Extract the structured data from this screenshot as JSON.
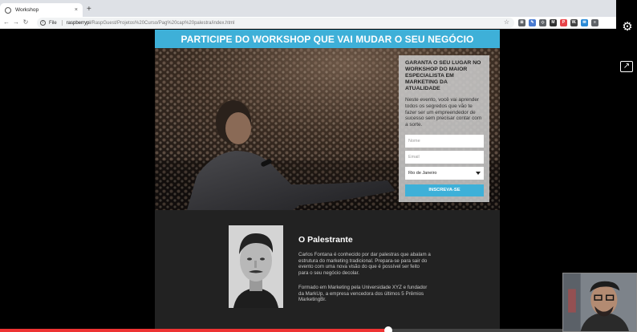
{
  "browser": {
    "tab_title": "Workshop",
    "tab_close": "×",
    "new_tab": "+",
    "back": "←",
    "forward": "→",
    "reload": "↻",
    "scheme_label": "File",
    "url_host": "raspberrypi",
    "url_path": "/RaspGuest/Projetos%20Curso/Pag%20cap%20palestra/index.html",
    "bookmark_star": "☆",
    "extensions": [
      {
        "icon": "grid-icon",
        "color": "#5f6368",
        "label": "⊞"
      },
      {
        "icon": "pin-icon",
        "color": "#4a7bd1",
        "label": "✎"
      },
      {
        "icon": "tag-icon",
        "color": "#5f6368",
        "label": "◇"
      },
      {
        "icon": "m-icon",
        "color": "#333333",
        "label": "M"
      },
      {
        "icon": "pocket-icon",
        "color": "#e8444a",
        "label": "P"
      },
      {
        "icon": "w-icon",
        "color": "#444444",
        "label": "W."
      },
      {
        "icon": "chat-icon",
        "color": "#2b8ad6",
        "label": "✉"
      },
      {
        "icon": "menu-icon",
        "color": "#5f6368",
        "label": "≡"
      }
    ]
  },
  "side_icons": {
    "settings": "⚙",
    "share": "↗"
  },
  "page": {
    "banner": "PARTICIPE DO WORKSHOP QUE VAI MUDAR O SEU NEGÓCIO",
    "form": {
      "title": "GARANTA O SEU LUGAR NO WORKSHOP DO MAIOR ESPECIALISTA EM MARKETING DA ATUALIDADE",
      "text": "Neste evento, você vai aprender todos os segredos que vão te fazer ser um empreendedor de sucesso sem precisar contar com a sorte.",
      "name_placeholder": "Nome",
      "email_placeholder": "Email",
      "city_selected": "Rio de Janeiro",
      "submit_label": "INSCREVA-SE"
    },
    "speaker": {
      "title": "O Palestrante",
      "p1": "Carlos Fontana é conhecido por dar palestras que abalam a estrutura do marketing tradicional. Prepara-se para sair do evento com uma nova visão do que é possível ser feito para o seu negócio decolar.",
      "p2": "Formado em Marketing pela Universidade XYZ e fundador da MarkUp, a empresa vencedora dos últimos 5 Prêmios MarketingBr."
    }
  },
  "video": {
    "progress_fraction": 0.69
  }
}
